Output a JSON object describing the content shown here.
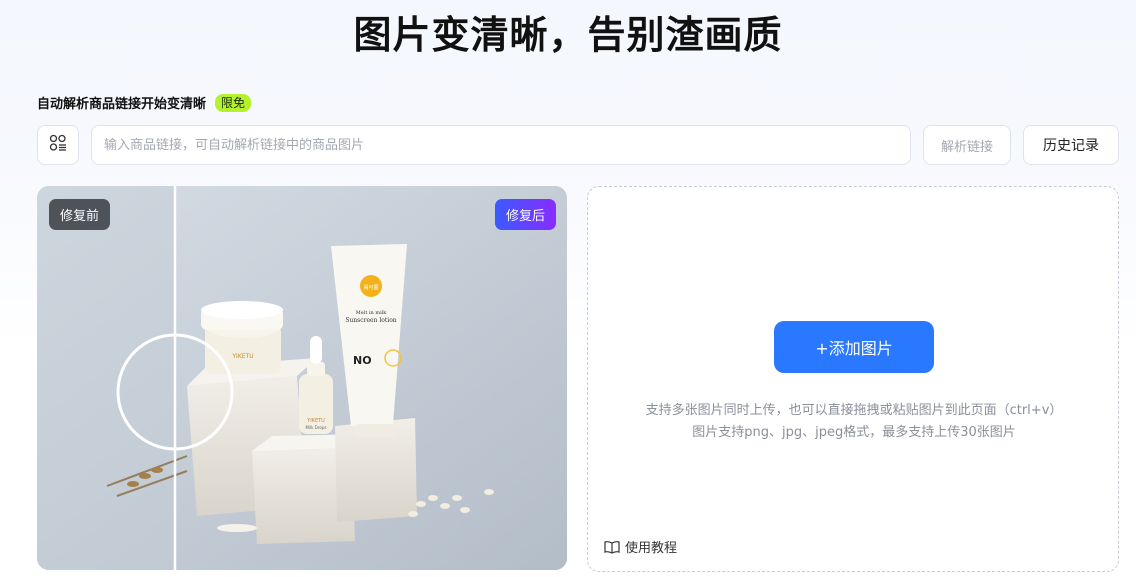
{
  "headline": "图片变清晰，告别渣画质",
  "link_section": {
    "label": "自动解析商品链接开始变清晰",
    "badge": "限免",
    "input_placeholder": "输入商品链接，可自动解析链接中的商品图片",
    "parse_button": "解析链接",
    "history_button": "历史记录"
  },
  "compare": {
    "before_label": "修复前",
    "after_label": "修复后",
    "brand_logo": "易可图",
    "tube_line1": "Melt in milk",
    "tube_line2": "Sunscreen lotion",
    "tube_no": "NO",
    "jar_brand": "YIKETU",
    "bottle_brand": "YIKETU",
    "bottle_sub": "Milk Drops"
  },
  "upload": {
    "add_button": "+添加图片",
    "hint_line1": "支持多张图片同时上传，也可以直接拖拽或粘贴图片到此页面（ctrl+v）",
    "hint_line2": "图片支持png、jpg、jpeg格式，最多支持上传30张图片",
    "tutorial_label": "使用教程"
  },
  "colors": {
    "accent": "#2a78ff",
    "badge_bg": "#b4f22e",
    "after_gradient_start": "#3a5bff",
    "after_gradient_end": "#8a2bff"
  },
  "icons": {
    "grid": "grid-list-icon",
    "book": "book-icon"
  }
}
